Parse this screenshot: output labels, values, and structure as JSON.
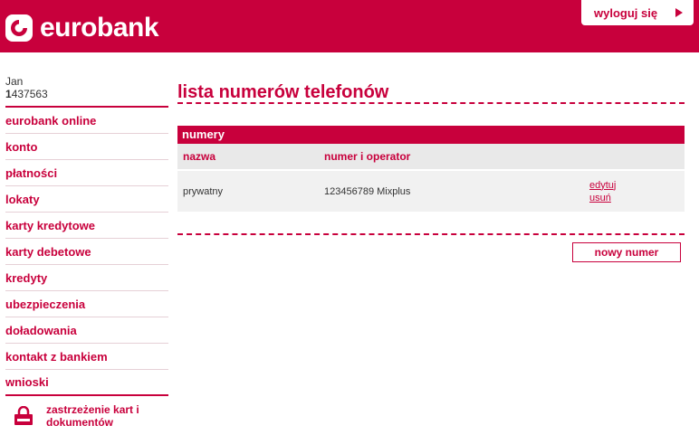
{
  "header": {
    "brand": "eurobank",
    "logout_label": "wyloguj się",
    "brand_color": "#c8003c"
  },
  "user": {
    "first_name": "Jan",
    "id_first_digit": "1",
    "id_rest": "437563"
  },
  "sidebar": {
    "items": [
      {
        "label": "eurobank online"
      },
      {
        "label": "konto"
      },
      {
        "label": "płatności"
      },
      {
        "label": "lokaty"
      },
      {
        "label": "karty kredytowe"
      },
      {
        "label": "karty debetowe"
      },
      {
        "label": "kredyty"
      },
      {
        "label": "ubezpieczenia"
      },
      {
        "label": "doładowania"
      },
      {
        "label": "kontakt z bankiem"
      },
      {
        "label": "wnioski"
      }
    ],
    "card_lock_label": "zastrzeżenie kart i dokumentów",
    "card_lock_icon": "padlock-icon"
  },
  "main": {
    "title": "lista numerów telefonów",
    "panel_title": "numery",
    "columns": [
      "nazwa",
      "numer i operator"
    ],
    "rows": [
      {
        "name": "prywatny",
        "number": "123456789 Mixplus",
        "edit_label": "edytuj",
        "delete_label": "usuń"
      }
    ],
    "new_button_label": "nowy numer"
  }
}
